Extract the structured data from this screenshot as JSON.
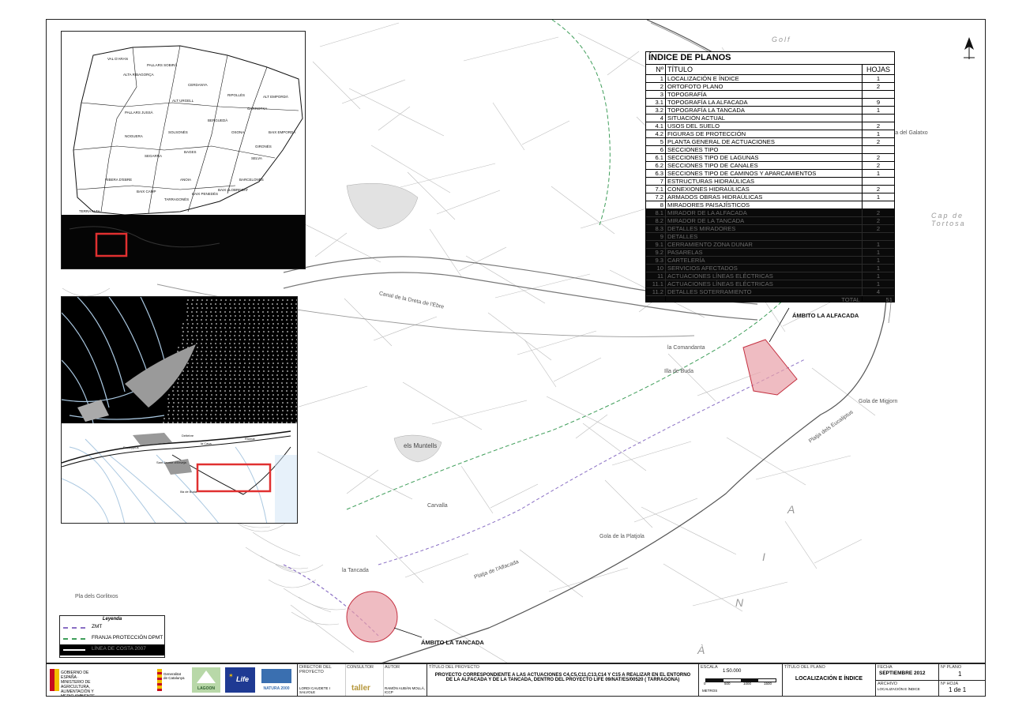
{
  "index": {
    "heading": "ÍNDICE DE PLANOS",
    "col_no": "Nº",
    "col_title": "TÍTULO",
    "col_sheets": "HOJAS",
    "rows": [
      {
        "n": "1",
        "t": "LOCALIZACIÓN  E ÍNDICE",
        "h": "1",
        "dark": false
      },
      {
        "n": "2",
        "t": "ORTOFOTO PLANO",
        "h": "2",
        "dark": false
      },
      {
        "n": "3",
        "t": "TOPOGRAFÍA",
        "h": "",
        "dark": false
      },
      {
        "n": "3.1",
        "t": "TOPOGRAFÍA LA ALFACADA",
        "h": "9",
        "dark": false
      },
      {
        "n": "3.2",
        "t": "TOPOGRAFÍA LA TANCADA",
        "h": "1",
        "dark": false
      },
      {
        "n": "4",
        "t": "SITUACIÓN ACTUAL",
        "h": "",
        "dark": false
      },
      {
        "n": "4.1",
        "t": "USOS DEL SUELO",
        "h": "2",
        "dark": false
      },
      {
        "n": "4.2",
        "t": "FIGURAS DE PROTECCIÓN",
        "h": "1",
        "dark": false
      },
      {
        "n": "5",
        "t": "PLANTA GENERAL DE ACTUACIONES",
        "h": "2",
        "dark": false
      },
      {
        "n": "6",
        "t": "SECCIONES TIPO",
        "h": "",
        "dark": false
      },
      {
        "n": "6.1",
        "t": "SECCIONES TIPO DE LAGUNAS",
        "h": "2",
        "dark": false
      },
      {
        "n": "6.2",
        "t": "SECCIONES TIPO DE CANALES",
        "h": "2",
        "dark": false
      },
      {
        "n": "6.3",
        "t": "SECCIONES TIPO DE CAMINOS Y APARCAMIENTOS",
        "h": "1",
        "dark": false
      },
      {
        "n": "7",
        "t": "ESTRUCTURAS HIDRAÚLICAS",
        "h": "",
        "dark": false
      },
      {
        "n": "7.1",
        "t": "CONEXIONES HIDRAÚLICAS",
        "h": "2",
        "dark": false
      },
      {
        "n": "7.2",
        "t": "ARMADOS OBRAS HIDRAÚLICAS",
        "h": "1",
        "dark": false
      },
      {
        "n": "8",
        "t": "MIRADORES PAISAJÍSTICOS",
        "h": "",
        "dark": false
      },
      {
        "n": "8.1",
        "t": "MIRADOR DE LA ALFACADA",
        "h": "2",
        "dark": true
      },
      {
        "n": "8.2",
        "t": "MIRADOR DE LA TANCADA",
        "h": "2",
        "dark": true
      },
      {
        "n": "8.3",
        "t": "DETALLES MIRADORES",
        "h": "2",
        "dark": true
      },
      {
        "n": "9",
        "t": "DETALLES",
        "h": "",
        "dark": true
      },
      {
        "n": "9.1",
        "t": "CERRAMIENTO ZONA DUNAR",
        "h": "1",
        "dark": true
      },
      {
        "n": "9.2",
        "t": "PASARELAS",
        "h": "1",
        "dark": true
      },
      {
        "n": "9.3",
        "t": "CARTELERÍA",
        "h": "1",
        "dark": true
      },
      {
        "n": "10",
        "t": "SERVICIOS AFECTADOS",
        "h": "1",
        "dark": true
      },
      {
        "n": "11",
        "t": "ACTUACIONES LÍNEAS ELÉCTRICAS",
        "h": "1",
        "dark": true
      },
      {
        "n": "11.1",
        "t": "ACTUACIONES LÍNEAS ELÉCTRICAS",
        "h": "1",
        "dark": true
      },
      {
        "n": "11.2",
        "t": "DETALLES SOTERRAMIENTO",
        "h": "4",
        "dark": true
      }
    ],
    "total_label": "TOTAL",
    "total_value": "51"
  },
  "map": {
    "golf_label": "Golf",
    "sea_letters": [
      "À",
      "N",
      "I",
      "A"
    ],
    "cap_label": "Cap de Tortosa",
    "ambito_alfacada": "ÁMBITO LA ALFACADA",
    "ambito_tancada": "ÁMBITO LA TANCADA",
    "place_labels": [
      "els Muntells",
      "la Tancada",
      "Gola de Migjorn",
      "Platja dels Eucaliptus",
      "Canal de la Dreta de l'Ebre",
      "Punta del Galatxo",
      "Pla dels Gorlitxos",
      "Carvalla",
      "la Comandanta",
      "Illa de Buda",
      "Gola de la Platjola",
      "Platja de l'Alfacada"
    ]
  },
  "inset_catalonia": {
    "counties": [
      "VAL D'ARAN",
      "PALLARS SOBIRÀ",
      "ALTA RIBAGORÇA",
      "CERDANYA",
      "ALT URGELL",
      "PALLARS JUSSÀ",
      "RIPOLLÈS",
      "GARROTXA",
      "ALT EMPORDÀ",
      "BERGUEDÀ",
      "SOLSONÈS",
      "OSONA",
      "NOGUERA",
      "BAIX EMPORDÀ",
      "GIRONÈS",
      "SELVA",
      "SEGARRA",
      "BAGES",
      "ANOIA",
      "BAIX PENEDÈS",
      "BAIX LLOBREGAT",
      "BARCELONÈS",
      "TARRAGONÈS",
      "BAIX CAMP",
      "RIBERA D'EBRE",
      "TERRA ALTA"
    ]
  },
  "inset_delta": {
    "labels": [
      "Deltebre",
      "la Cava",
      "Eucalyptus",
      "Riumar",
      "Sant Jaume d'Enveja",
      "Illa de Buda"
    ]
  },
  "legend": {
    "title": "Leyenda",
    "items": [
      {
        "label": "ZMT",
        "color": "#8a6fc4"
      },
      {
        "label": "FRANJA PROTECCIÓN DPMT",
        "color": "#3f9e5a"
      },
      {
        "label": "LÍNEA DE COSTA 2007",
        "color": "#ffffff"
      }
    ]
  },
  "titleblock": {
    "director_heading": "DIRECTOR DEL PROYECTO",
    "director_name": "LORDI CAUDETE I SALVOLE",
    "consultor_heading": "CONSULTOR",
    "consultor_name": "taller",
    "autor_heading": "AUTOR",
    "autor_name": "RAMÓN AUBÁN MOLLÀ, ICCP",
    "project_heading": "TÍTULO DEL PROYECTO",
    "project_line1": "PROYECTO CORRESPONDIENTE A LAS ACTUACIONES C4,C5,C11,C13,C14 Y C15 A REALIZAR EN EL ENTORNO",
    "project_line2": "DE LA ALFACADA Y DE LA TANCADA, DENTRO DEL PROYECTO LIFE 09/NAT/ES/00520 ( TARRAGONA)",
    "scale_heading": "ESCALA",
    "scale_value": "1:50.000",
    "scale_ticks": [
      "0",
      "500",
      "1000",
      "1500"
    ],
    "scale_units": "METROS",
    "plano_heading": "TÍTULO DEL PLANO",
    "plano_title": "LOCALIZACIÓN E ÍNDICE",
    "fecha_heading": "FECHA",
    "fecha_value": "SEPTIEMBRE 2012",
    "archivo_heading": "ARCHIVO",
    "archivo_value": "LOCALIZACIÓN E ÍNDICE",
    "plano_no_heading": "Nº PLANO",
    "plano_no_value": "1",
    "hoja_heading": "Nº HOJA",
    "hoja_value": "1 de 1",
    "logo_ministry": "GOBIERNO DE ESPAÑA · MINISTERIO DE AGRICULTURA, ALIMENTACIÓN Y MEDIO AMBIENTE",
    "logo_generalitat": "Generalitat de Catalunya",
    "logo_lagoon": "LAGOON",
    "logo_life": "Life",
    "logo_natura": "NATURA 2000"
  }
}
